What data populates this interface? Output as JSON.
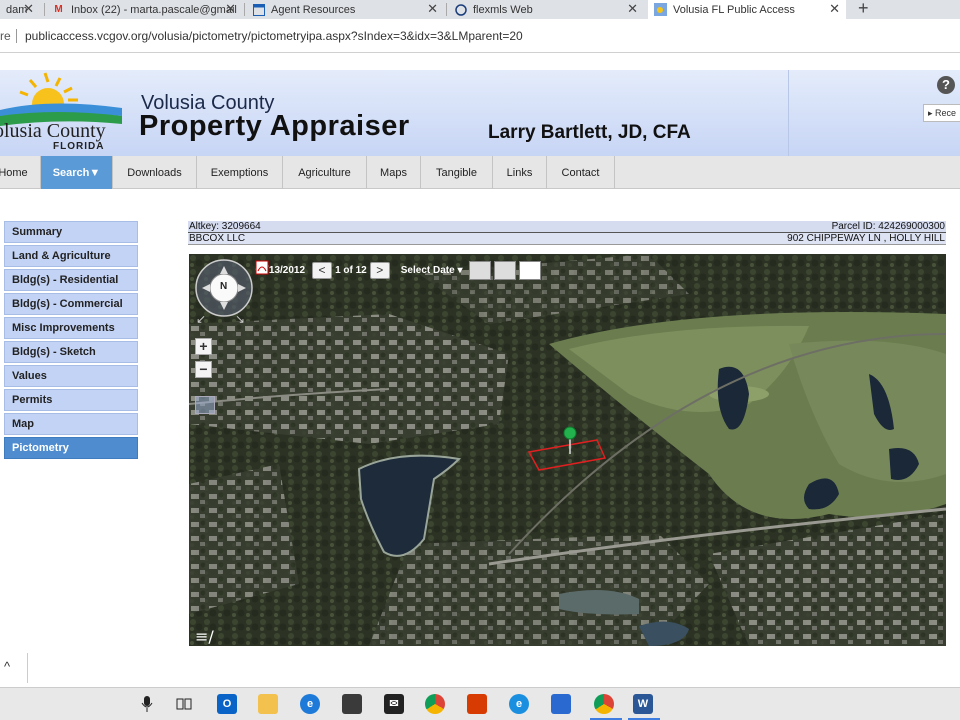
{
  "browser": {
    "tabs": [
      {
        "title": "dam",
        "icon": "doc-icon"
      },
      {
        "title": "Inbox (22) - marta.pascale@gmail",
        "icon": "gmail-icon"
      },
      {
        "title": "Agent Resources",
        "icon": "page-icon"
      },
      {
        "title": "flexmls Web",
        "icon": "flexmls-icon"
      },
      {
        "title": "Volusia FL Public Access",
        "icon": "volusia-icon",
        "active": true
      }
    ],
    "new_tab": "+",
    "address_prefix": "re",
    "url": "publicaccess.vcgov.org/volusia/pictometry/pictometryipa.aspx?sIndex=3&idx=3&LMparent=20"
  },
  "header": {
    "logo_line1": "olusia County",
    "logo_line2": "FLORIDA",
    "county": "Volusia County",
    "title": "Property Appraiser",
    "appraiser": "Larry Bartlett, JD, CFA",
    "help": "?",
    "recent": "▸ Rece"
  },
  "nav": {
    "items": [
      "Home",
      "Search▼",
      "Downloads",
      "Exemptions",
      "Agriculture",
      "Maps",
      "Tangible",
      "Links",
      "Contact"
    ],
    "active_index": 1
  },
  "sidebar": {
    "items": [
      "Summary",
      "Land & Agriculture",
      "Bldg(s) - Residential",
      "Bldg(s) - Commercial",
      "Misc Improvements",
      "Bldg(s) - Sketch",
      "Values",
      "Permits",
      "Map",
      "Pictometry"
    ],
    "active_index": 9
  },
  "property": {
    "altkey": "Altkey: 3209664",
    "parcel": "Parcel ID: 424269000300",
    "owner": "BBCOX LLC",
    "address": "902 CHIPPEWAY LN , HOLLY HILL"
  },
  "pictometry": {
    "date": "02/13/2012",
    "prev": "<",
    "count": "1 of 12",
    "next": ">",
    "select_date": "Select Date ▾",
    "compass_label": "N",
    "zoom_in": "+",
    "zoom_out": "−"
  },
  "colors": {
    "accent": "#5a9ad6",
    "sidebar_bg": "#c3d3f5",
    "parcel_outline": "#e02020",
    "pin": "#22b14c"
  }
}
